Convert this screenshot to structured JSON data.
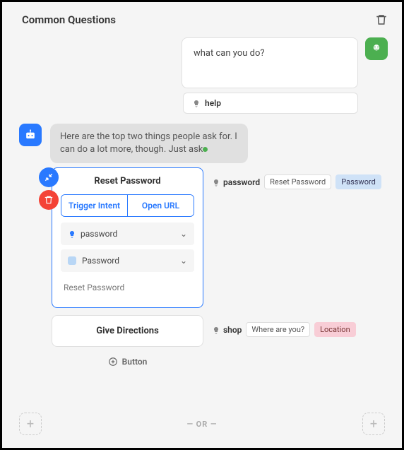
{
  "header": {
    "title": "Common Questions"
  },
  "user_message": "what can you do?",
  "help_pill": "help",
  "bot_message": "Here are the top two things people ask for. I can do a lot more, though. Just ask",
  "card1": {
    "title": "Reset Password",
    "tabs": {
      "trigger": "Trigger Intent",
      "url": "Open URL"
    },
    "field_password": "password",
    "field_entity": "Password",
    "field_phrase": "Reset Password"
  },
  "annot1": {
    "label": "password",
    "chip1": "Reset Password",
    "chip2": "Password"
  },
  "card2": {
    "title": "Give Directions"
  },
  "annot2": {
    "label": "shop",
    "chip1": "Where are you?",
    "chip2": "Location"
  },
  "add_button": "Button",
  "or": "—  OR  —"
}
